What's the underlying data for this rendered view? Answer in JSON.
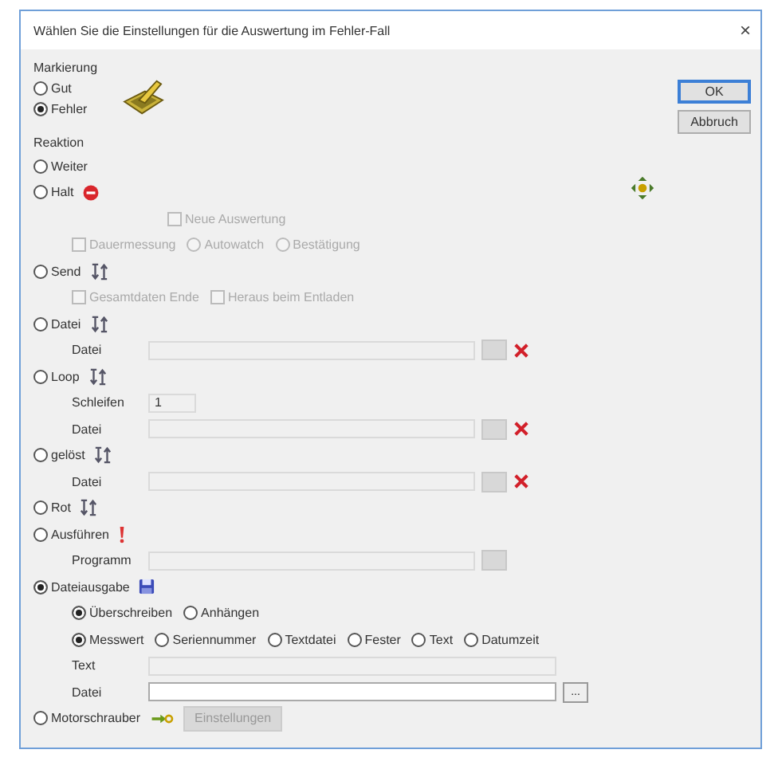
{
  "window": {
    "title": "Wählen Sie die Einstellungen für die Auswertung im Fehler-Fall",
    "close": "×"
  },
  "marking": {
    "label": "Markierung",
    "options": [
      {
        "label": "Gut",
        "selected": false
      },
      {
        "label": "Fehler",
        "selected": true
      }
    ]
  },
  "buttons": [
    {
      "label": "OK",
      "default": true
    },
    {
      "label": "Abbruch",
      "default": false
    }
  ],
  "reaction": {
    "label": "Reaktion",
    "options": [
      {
        "kind": "plain",
        "label": "Weiter",
        "selected": false
      },
      {
        "kind": "stop",
        "label": "Halt",
        "selected": false,
        "sub": [
          {
            "items": [
              {
                "kind": "checkbox",
                "label": "Neue Auswertung",
                "checked": false,
                "disabled": true
              }
            ]
          },
          {
            "items": [
              {
                "kind": "checkbox",
                "label": "Dauermessung",
                "checked": false,
                "disabled": true
              },
              {
                "kind": "radio",
                "label": "Autowatch",
                "selected": false,
                "disabled": true
              },
              {
                "kind": "radio",
                "label": "Bestätigung",
                "selected": false,
                "disabled": true
              }
            ]
          }
        ]
      },
      {
        "kind": "transfer",
        "label": "Send",
        "selected": false,
        "sub": [
          {
            "items": [
              {
                "kind": "checkbox",
                "label": "Gesamtdaten Ende",
                "checked": false,
                "disabled": true
              },
              {
                "kind": "checkbox",
                "label": "Heraus beim Entladen",
                "checked": false,
                "disabled": true
              }
            ]
          }
        ]
      },
      {
        "kind": "transfer",
        "label": "Datei",
        "selected": false,
        "sub": [
          {
            "items": [
              {
                "kind": "field",
                "label": "Datei",
                "disabled": true,
                "browse": true,
                "delete": true
              }
            ]
          }
        ]
      },
      {
        "kind": "transfer",
        "label": "Loop",
        "selected": false,
        "sub": [
          {
            "items": [
              {
                "kind": "short-field",
                "label": "Schleifen",
                "value": "1",
                "disabled": true
              }
            ]
          },
          {
            "items": [
              {
                "kind": "field",
                "label": "Datei",
                "disabled": true,
                "browse": true,
                "delete": true
              }
            ]
          }
        ]
      },
      {
        "kind": "transfer",
        "label": "gelöst",
        "selected": false,
        "sub": [
          {
            "items": [
              {
                "kind": "field",
                "label": "Datei",
                "disabled": true,
                "browse": true,
                "delete": true
              }
            ]
          }
        ]
      },
      {
        "kind": "transfer",
        "label": "Rot",
        "selected": false
      },
      {
        "kind": "alert",
        "label": "Ausführen",
        "selected": false,
        "sub": [
          {
            "items": [
              {
                "kind": "field",
                "label": "Programm",
                "disabled": true,
                "browse": true
              }
            ]
          }
        ]
      },
      {
        "kind": "disk",
        "label": "Dateiausgabe",
        "selected": true,
        "sub": [
          {
            "items": [
              {
                "kind": "radio",
                "label": "Überschreiben",
                "selected": true,
                "disabled": false
              },
              {
                "kind": "radio",
                "label": "Anhängen",
                "selected": false,
                "disabled": false
              }
            ]
          },
          {
            "items": [
              {
                "kind": "radio",
                "label": "Messwert",
                "selected": true,
                "disabled": false
              },
              {
                "kind": "radio",
                "label": "Seriennummer",
                "selected": false,
                "disabled": false
              },
              {
                "kind": "radio",
                "label": "Textdatei",
                "selected": false,
                "disabled": false
              },
              {
                "kind": "radio",
                "label": "Fester",
                "selected": false,
                "disabled": false
              },
              {
                "kind": "radio",
                "label": "Text",
                "selected": false,
                "disabled": false
              },
              {
                "kind": "radio",
                "label": "Datumzeit",
                "selected": false,
                "disabled": false
              }
            ]
          },
          {
            "items": [
              {
                "kind": "long-field",
                "label": "Text",
                "disabled": true
              }
            ]
          },
          {
            "items": [
              {
                "kind": "long-field",
                "label": "Datei",
                "disabled": false,
                "browse": true,
                "browse_label": "..."
              }
            ]
          }
        ]
      },
      {
        "kind": "plug",
        "label": "Motorschrauber",
        "selected": false,
        "button": "Einstellungen"
      }
    ]
  }
}
